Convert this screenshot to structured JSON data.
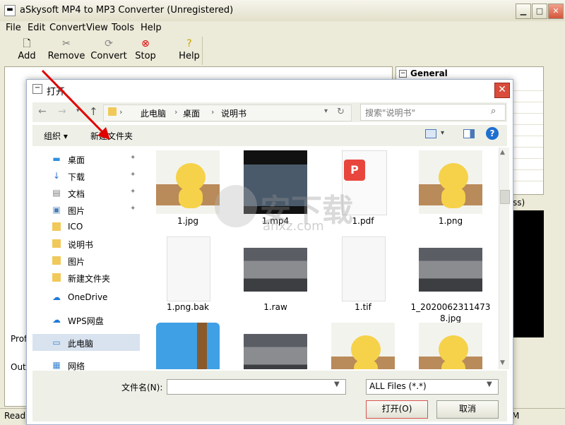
{
  "app": {
    "title": "aSkysoft MP4 to MP3 Converter (Unregistered)",
    "menu": [
      "File",
      "Edit",
      "Convert",
      "View",
      "Tools",
      "Help"
    ],
    "toolbar": [
      {
        "label": "Add",
        "icon": "add-file-icon"
      },
      {
        "label": "Remove",
        "icon": "remove-tools-icon"
      },
      {
        "label": "Convert",
        "icon": "convert-icon"
      },
      {
        "label": "Stop",
        "icon": "stop-icon"
      },
      {
        "label": "Help",
        "icon": "help-bulb-icon"
      }
    ],
    "panel_header": "General",
    "left_labels": {
      "profile": "Profi",
      "output": "Outp"
    },
    "status": "Read",
    "right_fragment": "ss)",
    "status_right": "M"
  },
  "dialog": {
    "title": "打开",
    "breadcrumb": [
      "此电脑",
      "桌面",
      "说明书"
    ],
    "search_placeholder": "搜索\"说明书\"",
    "organize": "组织 ▾",
    "new_folder": "新建文件夹",
    "nav": [
      {
        "label": "桌面",
        "icon": "desktop-icon",
        "pinned": true
      },
      {
        "label": "下载",
        "icon": "download-icon",
        "pinned": true
      },
      {
        "label": "文档",
        "icon": "document-icon",
        "pinned": true
      },
      {
        "label": "图片",
        "icon": "picture-icon",
        "pinned": true
      },
      {
        "label": "ICO",
        "icon": "folder-icon",
        "pinned": false
      },
      {
        "label": "说明书",
        "icon": "folder-icon",
        "pinned": false
      },
      {
        "label": "图片",
        "icon": "folder-icon",
        "pinned": false
      },
      {
        "label": "新建文件夹",
        "icon": "folder-icon",
        "pinned": false
      },
      {
        "label": "OneDrive",
        "icon": "cloud-icon",
        "pinned": false
      },
      {
        "label": "WPS网盘",
        "icon": "wps-cloud-icon",
        "pinned": false
      },
      {
        "label": "此电脑",
        "icon": "computer-icon",
        "pinned": false
      },
      {
        "label": "网络",
        "icon": "network-icon",
        "pinned": false
      }
    ],
    "files": [
      {
        "name": "1.jpg",
        "kind": "cat"
      },
      {
        "name": "1.mp4",
        "kind": "video"
      },
      {
        "name": "1.pdf",
        "kind": "pdf"
      },
      {
        "name": "1.png",
        "kind": "cat"
      },
      {
        "name": "1.png.bak",
        "kind": "blank"
      },
      {
        "name": "1.raw",
        "kind": "dogs"
      },
      {
        "name": "1.tif",
        "kind": "blank"
      },
      {
        "name": "1_20200623114738.jpg",
        "kind": "dogs"
      },
      {
        "name": "",
        "kind": "zip"
      },
      {
        "name": "",
        "kind": "dogs"
      },
      {
        "name": "",
        "kind": "cat"
      },
      {
        "name": "",
        "kind": "cat"
      }
    ],
    "filename_label": "文件名(N):",
    "filename_value": "",
    "filetype_value": "ALL Files (*.*)",
    "open_button": "打开(O)",
    "cancel_button": "取消"
  },
  "watermark": {
    "text": "安下载",
    "sub": "anxz.com"
  }
}
